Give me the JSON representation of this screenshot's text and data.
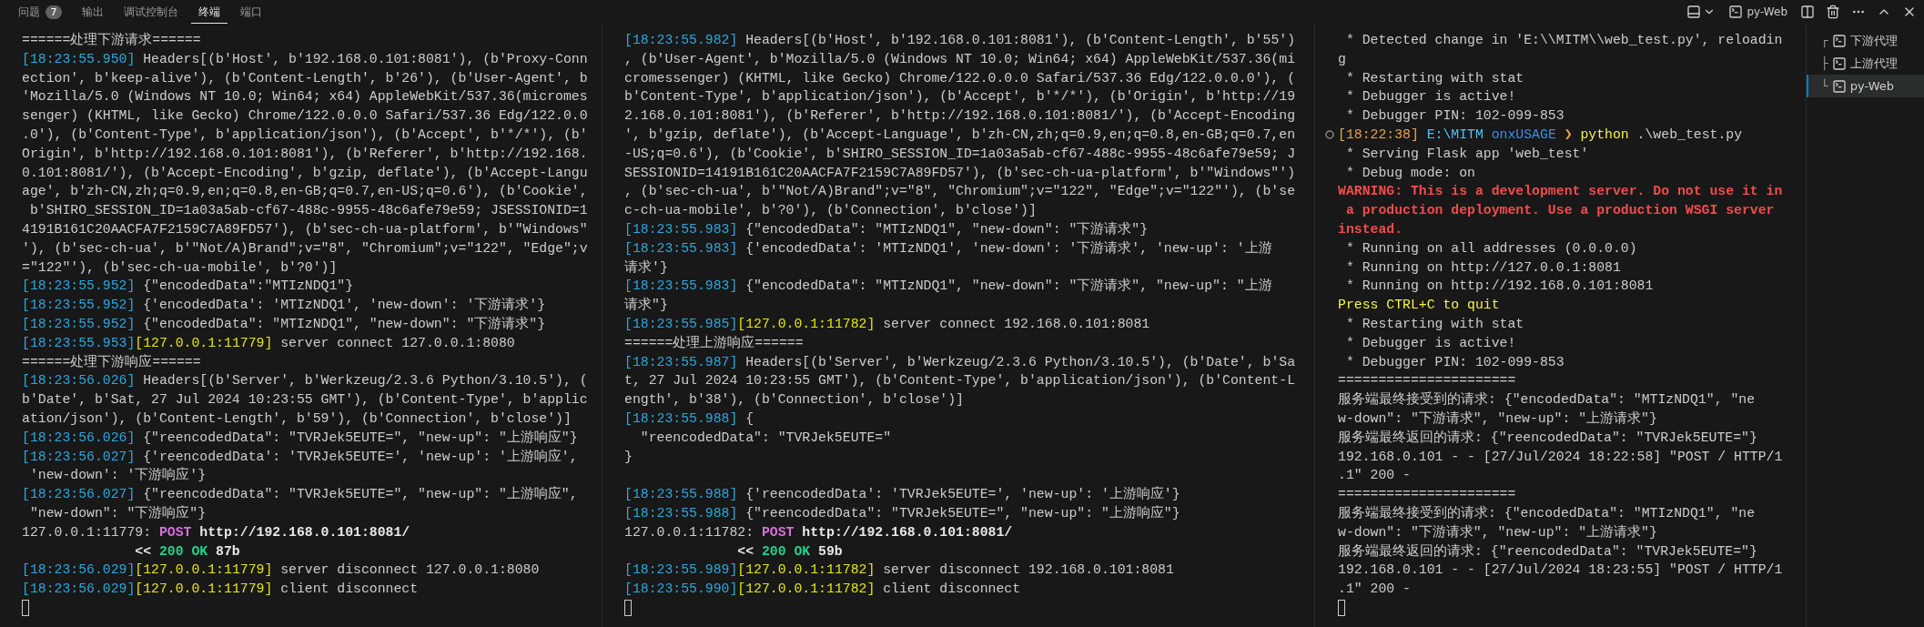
{
  "panel_tabs": [
    {
      "label": "问题",
      "badge": "7",
      "selected": false
    },
    {
      "label": "输出",
      "selected": false
    },
    {
      "label": "调试控制台",
      "selected": false
    },
    {
      "label": "终端",
      "selected": true
    },
    {
      "label": "端口",
      "selected": false
    }
  ],
  "toolbar": {
    "terminal_label": "py-Web"
  },
  "panes": [
    {
      "cursor": true,
      "lines": [
        {
          "segments": [
            {
              "kind": "plain",
              "text": "======处理下游请求======"
            }
          ]
        },
        {
          "segments": [
            {
              "kind": "time",
              "text": "[18:23:55.950]"
            },
            {
              "kind": "plain",
              "text": " Headers[(b'Host', b'192.168.0.101:8081'), (b'Proxy-Conn"
            }
          ]
        },
        {
          "segments": [
            {
              "kind": "plain",
              "text": "ection', b'keep-alive'), (b'Content-Length', b'26'), (b'User-Agent', b"
            }
          ]
        },
        {
          "segments": [
            {
              "kind": "plain",
              "text": "'Mozilla/5.0 (Windows NT 10.0; Win64; x64) AppleWebKit/537.36(micromes"
            }
          ]
        },
        {
          "segments": [
            {
              "kind": "plain",
              "text": "senger) (KHTML, like Gecko) Chrome/122.0.0.0 Safari/537.36 Edg/122.0.0"
            }
          ]
        },
        {
          "segments": [
            {
              "kind": "plain",
              "text": ".0'), (b'Content-Type', b'application/json'), (b'Accept', b'*/*'), (b'"
            }
          ]
        },
        {
          "segments": [
            {
              "kind": "plain",
              "text": "Origin', b'http://192.168.0.101:8081'), (b'Referer', b'http://192.168."
            }
          ]
        },
        {
          "segments": [
            {
              "kind": "plain",
              "text": "0.101:8081/'), (b'Accept-Encoding', b'gzip, deflate'), (b'Accept-Langu"
            }
          ]
        },
        {
          "segments": [
            {
              "kind": "plain",
              "text": "age', b'zh-CN,zh;q=0.9,en;q=0.8,en-GB;q=0.7,en-US;q=0.6'), (b'Cookie',"
            }
          ]
        },
        {
          "segments": [
            {
              "kind": "plain",
              "text": " b'SHIRO_SESSION_ID=1a03a5ab-cf67-488c-9955-48c6afe79e59; JSESSIONID=1"
            }
          ]
        },
        {
          "segments": [
            {
              "kind": "plain",
              "text": "4191B161C20AACFA7F2159C7A89FD57'), (b'sec-ch-ua-platform', b'\"Windows\""
            }
          ]
        },
        {
          "segments": [
            {
              "kind": "plain",
              "text": "'), (b'sec-ch-ua', b'\"Not/A)Brand\";v=\"8\", \"Chromium\";v=\"122\", \"Edge\";v"
            }
          ]
        },
        {
          "segments": [
            {
              "kind": "plain",
              "text": "=\"122\"'), (b'sec-ch-ua-mobile', b'?0')]"
            }
          ]
        },
        {
          "segments": [
            {
              "kind": "time",
              "text": "[18:23:55.952]"
            },
            {
              "kind": "plain",
              "text": " {\"encodedData\":\"MTIzNDQ1\"}"
            }
          ]
        },
        {
          "segments": [
            {
              "kind": "time",
              "text": "[18:23:55.952]"
            },
            {
              "kind": "plain",
              "text": " {'encodedData': 'MTIzNDQ1', 'new-down': '下游请求'}"
            }
          ]
        },
        {
          "segments": [
            {
              "kind": "time",
              "text": "[18:23:55.952]"
            },
            {
              "kind": "plain",
              "text": " {\"encodedData\": \"MTIzNDQ1\", \"new-down\": \"下游请求\"}"
            }
          ]
        },
        {
          "segments": [
            {
              "kind": "time",
              "text": "[18:23:55.953]"
            },
            {
              "kind": "addr",
              "text": "[127.0.0.1:11779]"
            },
            {
              "kind": "plain",
              "text": " server connect 127.0.0.1:8080"
            }
          ]
        },
        {
          "segments": [
            {
              "kind": "plain",
              "text": "======处理下游响应======"
            }
          ]
        },
        {
          "segments": [
            {
              "kind": "time",
              "text": "[18:23:56.026]"
            },
            {
              "kind": "plain",
              "text": " Headers[(b'Server', b'Werkzeug/2.3.6 Python/3.10.5'), ("
            }
          ]
        },
        {
          "segments": [
            {
              "kind": "plain",
              "text": "b'Date', b'Sat, 27 Jul 2024 10:23:55 GMT'), (b'Content-Type', b'applic"
            }
          ]
        },
        {
          "segments": [
            {
              "kind": "plain",
              "text": "ation/json'), (b'Content-Length', b'59'), (b'Connection', b'close')]"
            }
          ]
        },
        {
          "segments": [
            {
              "kind": "time",
              "text": "[18:23:56.026]"
            },
            {
              "kind": "plain",
              "text": " {\"reencodedData\": \"TVRJek5EUTE=\", \"new-up\": \"上游响应\"}"
            }
          ]
        },
        {
          "segments": [
            {
              "kind": "time",
              "text": "[18:23:56.027]"
            },
            {
              "kind": "plain",
              "text": " {'reencodedData': 'TVRJek5EUTE=', 'new-up': '上游响应',"
            }
          ]
        },
        {
          "segments": [
            {
              "kind": "plain",
              "text": " 'new-down': '下游响应'}"
            }
          ]
        },
        {
          "segments": [
            {
              "kind": "time",
              "text": "[18:23:56.027]"
            },
            {
              "kind": "plain",
              "text": " {\"reencodedData\": \"TVRJek5EUTE=\", \"new-up\": \"上游响应\","
            }
          ]
        },
        {
          "segments": [
            {
              "kind": "plain",
              "text": " \"new-down\": \"下游响应\"}"
            }
          ]
        },
        {
          "segments": [
            {
              "kind": "plain",
              "text": "127.0.0.1:11779: "
            },
            {
              "kind": "method",
              "text": "POST"
            },
            {
              "kind": "bold",
              "text": " http://192.168.0.101:8081/"
            }
          ]
        },
        {
          "segments": [
            {
              "kind": "bold",
              "text": "              << "
            },
            {
              "kind": "ok",
              "text": "200 OK"
            },
            {
              "kind": "bold",
              "text": " 87b"
            }
          ]
        },
        {
          "segments": [
            {
              "kind": "time",
              "text": "[18:23:56.029]"
            },
            {
              "kind": "addr",
              "text": "[127.0.0.1:11779]"
            },
            {
              "kind": "plain",
              "text": " server disconnect 127.0.0.1:8080"
            }
          ]
        },
        {
          "segments": [
            {
              "kind": "time",
              "text": "[18:23:56.029]"
            },
            {
              "kind": "addr",
              "text": "[127.0.0.1:11779]"
            },
            {
              "kind": "plain",
              "text": " client disconnect"
            }
          ]
        }
      ]
    },
    {
      "cursor": true,
      "lines": [
        {
          "segments": [
            {
              "kind": "time",
              "text": "[18:23:55.982]"
            },
            {
              "kind": "plain",
              "text": " Headers[(b'Host', b'192.168.0.101:8081'), (b'Content-Length', b'55')"
            }
          ]
        },
        {
          "segments": [
            {
              "kind": "plain",
              "text": ", (b'User-Agent', b'Mozilla/5.0 (Windows NT 10.0; Win64; x64) AppleWebKit/537.36(mi"
            }
          ]
        },
        {
          "segments": [
            {
              "kind": "plain",
              "text": "cromessenger) (KHTML, like Gecko) Chrome/122.0.0.0 Safari/537.36 Edg/122.0.0.0'), ("
            }
          ]
        },
        {
          "segments": [
            {
              "kind": "plain",
              "text": "b'Content-Type', b'application/json'), (b'Accept', b'*/*'), (b'Origin', b'http://19"
            }
          ]
        },
        {
          "segments": [
            {
              "kind": "plain",
              "text": "2.168.0.101:8081'), (b'Referer', b'http://192.168.0.101:8081/'), (b'Accept-Encoding"
            }
          ]
        },
        {
          "segments": [
            {
              "kind": "plain",
              "text": "', b'gzip, deflate'), (b'Accept-Language', b'zh-CN,zh;q=0.9,en;q=0.8,en-GB;q=0.7,en"
            }
          ]
        },
        {
          "segments": [
            {
              "kind": "plain",
              "text": "-US;q=0.6'), (b'Cookie', b'SHIRO_SESSION_ID=1a03a5ab-cf67-488c-9955-48c6afe79e59; J"
            }
          ]
        },
        {
          "segments": [
            {
              "kind": "plain",
              "text": "SESSIONID=14191B161C20AACFA7F2159C7A89FD57'), (b'sec-ch-ua-platform', b'\"Windows\"')"
            }
          ]
        },
        {
          "segments": [
            {
              "kind": "plain",
              "text": ", (b'sec-ch-ua', b'\"Not/A)Brand\";v=\"8\", \"Chromium\";v=\"122\", \"Edge\";v=\"122\"'), (b'se"
            }
          ]
        },
        {
          "segments": [
            {
              "kind": "plain",
              "text": "c-ch-ua-mobile', b'?0'), (b'Connection', b'close')]"
            }
          ]
        },
        {
          "segments": [
            {
              "kind": "time",
              "text": "[18:23:55.983]"
            },
            {
              "kind": "plain",
              "text": " {\"encodedData\": \"MTIzNDQ1\", \"new-down\": \"下游请求\"}"
            }
          ]
        },
        {
          "segments": [
            {
              "kind": "time",
              "text": "[18:23:55.983]"
            },
            {
              "kind": "plain",
              "text": " {'encodedData': 'MTIzNDQ1', 'new-down': '下游请求', 'new-up': '上游"
            }
          ]
        },
        {
          "segments": [
            {
              "kind": "plain",
              "text": "请求'}"
            }
          ]
        },
        {
          "segments": [
            {
              "kind": "time",
              "text": "[18:23:55.983]"
            },
            {
              "kind": "plain",
              "text": " {\"encodedData\": \"MTIzNDQ1\", \"new-down\": \"下游请求\", \"new-up\": \"上游"
            }
          ]
        },
        {
          "segments": [
            {
              "kind": "plain",
              "text": "请求\"}"
            }
          ]
        },
        {
          "segments": [
            {
              "kind": "time",
              "text": "[18:23:55.985]"
            },
            {
              "kind": "addr",
              "text": "[127.0.0.1:11782]"
            },
            {
              "kind": "plain",
              "text": " server connect 192.168.0.101:8081"
            }
          ]
        },
        {
          "segments": [
            {
              "kind": "plain",
              "text": "======处理上游响应======"
            }
          ]
        },
        {
          "segments": [
            {
              "kind": "time",
              "text": "[18:23:55.987]"
            },
            {
              "kind": "plain",
              "text": " Headers[(b'Server', b'Werkzeug/2.3.6 Python/3.10.5'), (b'Date', b'Sa"
            }
          ]
        },
        {
          "segments": [
            {
              "kind": "plain",
              "text": "t, 27 Jul 2024 10:23:55 GMT'), (b'Content-Type', b'application/json'), (b'Content-L"
            }
          ]
        },
        {
          "segments": [
            {
              "kind": "plain",
              "text": "ength', b'38'), (b'Connection', b'close')]"
            }
          ]
        },
        {
          "segments": [
            {
              "kind": "time",
              "text": "[18:23:55.988]"
            },
            {
              "kind": "plain",
              "text": " {"
            }
          ]
        },
        {
          "segments": [
            {
              "kind": "plain",
              "text": "  \"reencodedData\": \"TVRJek5EUTE=\""
            }
          ]
        },
        {
          "segments": [
            {
              "kind": "plain",
              "text": "}"
            }
          ]
        },
        {
          "blank_before": true,
          "segments": [
            {
              "kind": "time",
              "text": "[18:23:55.988]"
            },
            {
              "kind": "plain",
              "text": " {'reencodedData': 'TVRJek5EUTE=', 'new-up': '上游响应'}"
            }
          ]
        },
        {
          "segments": [
            {
              "kind": "time",
              "text": "[18:23:55.988]"
            },
            {
              "kind": "plain",
              "text": " {\"reencodedData\": \"TVRJek5EUTE=\", \"new-up\": \"上游响应\"}"
            }
          ]
        },
        {
          "segments": [
            {
              "kind": "plain",
              "text": "127.0.0.1:11782: "
            },
            {
              "kind": "method",
              "text": "POST"
            },
            {
              "kind": "bold",
              "text": " http://192.168.0.101:8081/"
            }
          ]
        },
        {
          "segments": [
            {
              "kind": "bold",
              "text": "              << "
            },
            {
              "kind": "ok",
              "text": "200 OK"
            },
            {
              "kind": "bold",
              "text": " 59b"
            }
          ]
        },
        {
          "segments": [
            {
              "kind": "time",
              "text": "[18:23:55.989]"
            },
            {
              "kind": "addr",
              "text": "[127.0.0.1:11782]"
            },
            {
              "kind": "plain",
              "text": " server disconnect 192.168.0.101:8081"
            }
          ]
        },
        {
          "segments": [
            {
              "kind": "time",
              "text": "[18:23:55.990]"
            },
            {
              "kind": "addr",
              "text": "[127.0.0.1:11782]"
            },
            {
              "kind": "plain",
              "text": " client disconnect"
            }
          ]
        }
      ]
    },
    {
      "cursor": true,
      "lines": [
        {
          "segments": [
            {
              "kind": "plain",
              "text": " * Detected change in 'E:\\\\MITM\\\\web_test.py', reloadin"
            }
          ]
        },
        {
          "segments": [
            {
              "kind": "plain",
              "text": "g"
            }
          ]
        },
        {
          "segments": [
            {
              "kind": "plain",
              "text": " * Restarting with stat"
            }
          ]
        },
        {
          "segments": [
            {
              "kind": "plain",
              "text": " * Debugger is active!"
            }
          ]
        },
        {
          "segments": [
            {
              "kind": "plain",
              "text": " * Debugger PIN: 102-099-853"
            }
          ]
        },
        {
          "mark": true,
          "segments": [
            {
              "kind": "ptime",
              "text": "[18:22:38]"
            },
            {
              "kind": "path",
              "text": " E:\\MITM"
            },
            {
              "kind": "branch",
              "text": " onxUSAGE"
            },
            {
              "kind": "chevron",
              "text": " ❯"
            },
            {
              "kind": "command",
              "text": " python"
            },
            {
              "kind": "plain",
              "text": " .\\web_test.py"
            }
          ]
        },
        {
          "segments": [
            {
              "kind": "plain",
              "text": " * Serving Flask app 'web_test'"
            }
          ]
        },
        {
          "segments": [
            {
              "kind": "plain",
              "text": " * Debug mode: on"
            }
          ]
        },
        {
          "segments": [
            {
              "kind": "warn",
              "text": "WARNING: This is a development server. Do not use it in"
            }
          ]
        },
        {
          "segments": [
            {
              "kind": "warn",
              "text": " a production deployment. Use a production WSGI server"
            }
          ]
        },
        {
          "segments": [
            {
              "kind": "warn",
              "text": "instead."
            }
          ]
        },
        {
          "segments": [
            {
              "kind": "plain",
              "text": " * Running on all addresses (0.0.0.0)"
            }
          ]
        },
        {
          "segments": [
            {
              "kind": "plain",
              "text": " * Running on http://127.0.0.1:8081"
            }
          ]
        },
        {
          "segments": [
            {
              "kind": "plain",
              "text": " * Running on http://192.168.0.101:8081"
            }
          ]
        },
        {
          "segments": [
            {
              "kind": "notice",
              "text": "Press CTRL+C to quit"
            }
          ]
        },
        {
          "segments": [
            {
              "kind": "plain",
              "text": " * Restarting with stat"
            }
          ]
        },
        {
          "segments": [
            {
              "kind": "plain",
              "text": " * Debugger is active!"
            }
          ]
        },
        {
          "segments": [
            {
              "kind": "plain",
              "text": " * Debugger PIN: 102-099-853"
            }
          ]
        },
        {
          "segments": [
            {
              "kind": "plain",
              "text": "======================"
            }
          ]
        },
        {
          "segments": [
            {
              "kind": "plain",
              "text": "服务端最终接受到的请求: {\"encodedData\": \"MTIzNDQ1\", \"ne"
            }
          ]
        },
        {
          "segments": [
            {
              "kind": "plain",
              "text": "w-down\": \"下游请求\", \"new-up\": \"上游请求\"}"
            }
          ]
        },
        {
          "segments": [
            {
              "kind": "plain",
              "text": "服务端最终返回的请求: {\"reencodedData\": \"TVRJek5EUTE=\"}"
            }
          ]
        },
        {
          "segments": [
            {
              "kind": "plain",
              "text": "192.168.0.101 - - [27/Jul/2024 18:22:58] \"POST / HTTP/1"
            }
          ]
        },
        {
          "segments": [
            {
              "kind": "plain",
              "text": ".1\" 200 -"
            }
          ]
        },
        {
          "segments": [
            {
              "kind": "plain",
              "text": "======================"
            }
          ]
        },
        {
          "segments": [
            {
              "kind": "plain",
              "text": "服务端最终接受到的请求: {\"encodedData\": \"MTIzNDQ1\", \"ne"
            }
          ]
        },
        {
          "segments": [
            {
              "kind": "plain",
              "text": "w-down\": \"下游请求\", \"new-up\": \"上游请求\"}"
            }
          ]
        },
        {
          "segments": [
            {
              "kind": "plain",
              "text": "服务端最终返回的请求: {\"reencodedData\": \"TVRJek5EUTE=\"}"
            }
          ]
        },
        {
          "segments": [
            {
              "kind": "plain",
              "text": "192.168.0.101 - - [27/Jul/2024 18:23:55] \"POST / HTTP/1"
            }
          ]
        },
        {
          "segments": [
            {
              "kind": "plain",
              "text": ".1\" 200 -"
            }
          ]
        }
      ]
    }
  ],
  "terminal_list": [
    {
      "tree": "┌",
      "label": "下游代理",
      "selected": false
    },
    {
      "tree": "├",
      "label": "上游代理",
      "selected": false
    },
    {
      "tree": "└",
      "label": "py-Web",
      "selected": true
    }
  ]
}
